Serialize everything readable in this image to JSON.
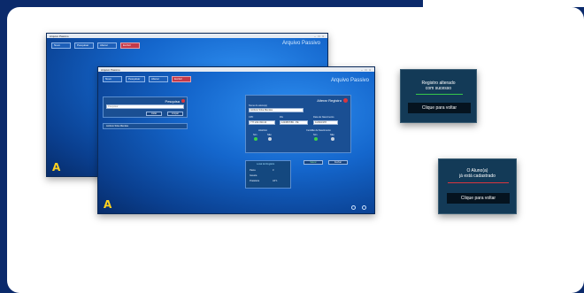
{
  "colors": {
    "page_bg": "#0b2a6b",
    "card_bg": "#ffffff",
    "success_bar": "#37c84a",
    "error_bar": "#d9363e",
    "accent_red": "#c23a4a"
  },
  "back_window": {
    "titlebar": "Arquivo Passivo",
    "window_controls": "– □ ×",
    "buttons": [
      "Novo",
      "Pesquisar",
      "Alterar",
      "Excluir"
    ],
    "title": "Arquivo Passivo",
    "logo": "A"
  },
  "front_window": {
    "titlebar": "Arquivo Passivo",
    "window_controls": "– □ ×",
    "buttons": [
      "Novo",
      "Pesquisar",
      "Alterar",
      "Excluir"
    ],
    "title": "Arquivo Passivo",
    "logo": "A",
    "search_panel": {
      "title": "Pesquisa",
      "placeholder": "Pesquisar",
      "search_button": "Listar",
      "clear_button": "Limpar",
      "result_item": "Antônio Silva Mendes"
    },
    "edit_panel": {
      "title": "Alterar Registro",
      "name_label": "Nome do aluno(a)",
      "name_value": "Antônio Silva Mendes",
      "cpf_label": "CPF",
      "cpf_value": "777.222.333-44",
      "rg_label": "RG",
      "rg_value": "1234567/89 - PE",
      "birth_label": "Data de Nascimento",
      "birth_value": "11/04/1978",
      "historico_label": "Histórico",
      "certidao_label": "Certidão de Nascimento",
      "sim": "Sim",
      "nao": "Não",
      "save_button": "Salvar",
      "cancel_button": "Fechar"
    },
    "location_panel": {
      "title": "Local do Registro",
      "row1_label": "Pasta",
      "row1_value": "3",
      "row2_label": "Gaveta",
      "row2_value": "",
      "row3_label": "Prateleira",
      "row3_value": "AP 1"
    }
  },
  "dialog_success": {
    "line1": "Registro alterado",
    "line2": "com sucesso",
    "button": "Clique para voltar"
  },
  "dialog_error": {
    "line1": "O Aluno(a)",
    "line2": "já está cadastrado",
    "button": "Clique para voltar"
  }
}
